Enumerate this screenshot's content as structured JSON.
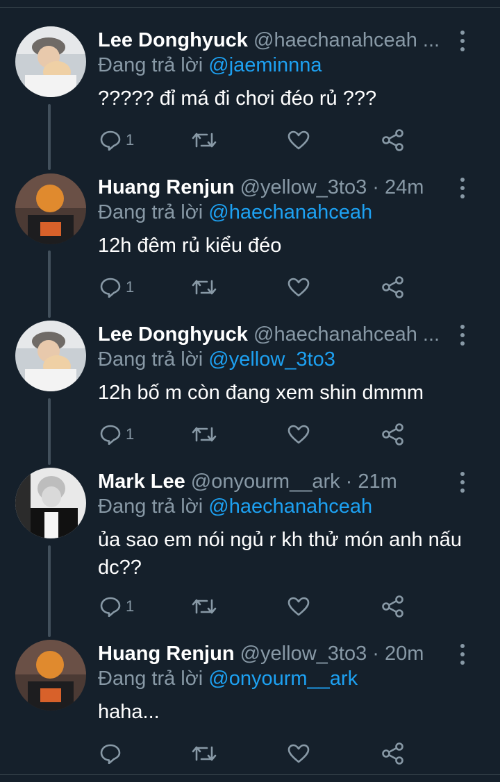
{
  "reply_prefix": "Đang trả lời",
  "colors": {
    "background": "#15202b",
    "secondary_text": "#8899a6",
    "mention": "#1da1f2",
    "divider": "#38444d"
  },
  "icons": {
    "reply": "comment-icon",
    "retweet": "retweet-icon",
    "like": "heart-icon",
    "share": "share-icon",
    "more": "more-vertical-icon"
  },
  "tweets": [
    {
      "name": "Lee Donghyuck",
      "handle": "@haechanahceah ...",
      "reply_to": "@jaeminnna",
      "text": "????? đỉ má đi chơi đéo rủ ???",
      "reply_count": "1"
    },
    {
      "name": "Huang Renjun",
      "handle": "@yellow_3to3 · 24m",
      "reply_to": "@haechanahceah",
      "text": "12h đêm rủ kiểu đéo",
      "reply_count": "1"
    },
    {
      "name": "Lee Donghyuck",
      "handle": "@haechanahceah ...",
      "reply_to": "@yellow_3to3",
      "text": "12h bố m còn đang xem shin dmmm",
      "reply_count": "1"
    },
    {
      "name": "Mark Lee",
      "handle": "@onyourm__ark · 21m",
      "reply_to": "@haechanahceah",
      "text": "ủa sao em nói ngủ r kh thử món anh nấu dc??",
      "reply_count": "1"
    },
    {
      "name": "Huang Renjun",
      "handle": "@yellow_3to3 · 20m",
      "reply_to": "@onyourm__ark",
      "text": "haha...",
      "reply_count": ""
    }
  ]
}
